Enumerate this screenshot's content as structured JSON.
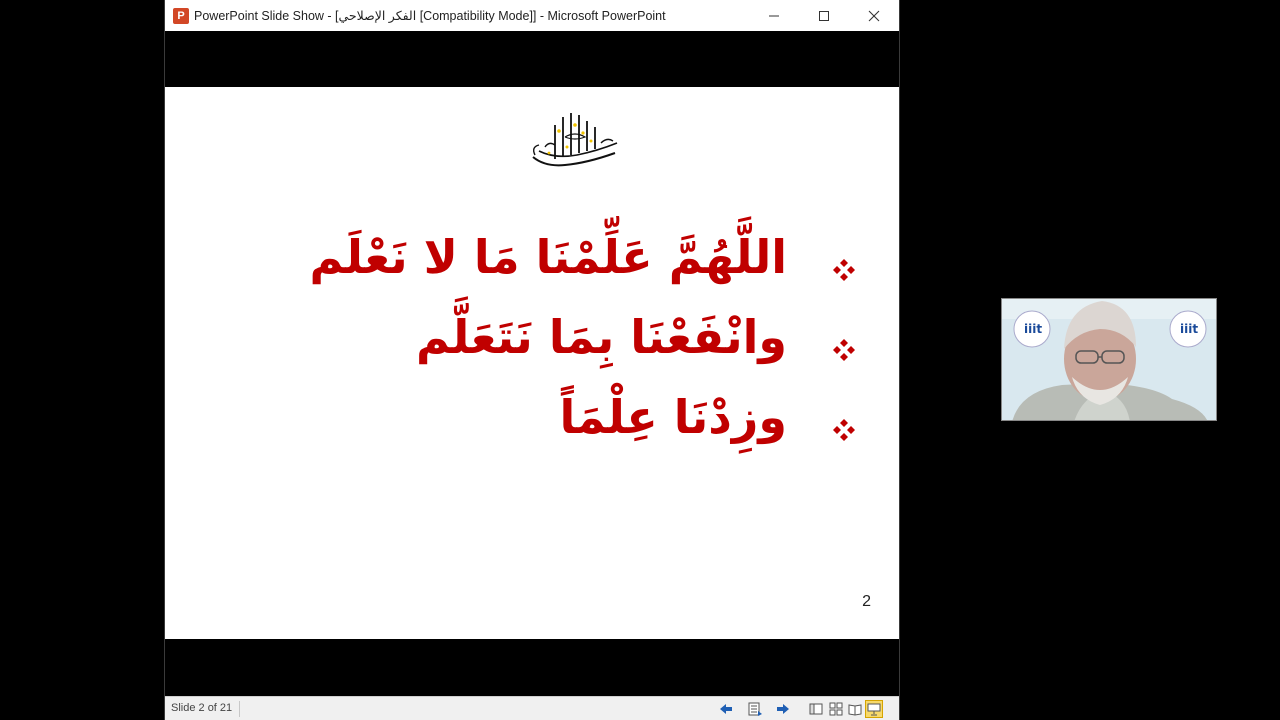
{
  "window": {
    "title": "PowerPoint Slide Show - [الفكر الإصلاحي [Compatibility Mode]] - Microsoft PowerPoint",
    "app_icon_letter": "P"
  },
  "slide": {
    "verses": [
      "اللَّهُمَّ عَلِّمْنَا مَا لا نَعْلَم",
      "وانْفَعْنَا بِمَا نَتَعَلَّم",
      "وزِدْنَا عِلْمَاً"
    ],
    "page_number": "2"
  },
  "statusbar": {
    "slide_counter": "Slide 2 of 21"
  },
  "colors": {
    "verse_text": "#c00000",
    "bullet": "#c00000",
    "accent_yellow": "#f2c400"
  },
  "icons": {
    "window_controls": [
      "minimize-icon",
      "maximize-icon",
      "close-icon"
    ],
    "statusbar": [
      "previous-slide-icon",
      "slide-menu-icon",
      "next-slide-icon",
      "normal-view-icon",
      "slide-sorter-icon",
      "reading-view-icon",
      "slide-show-icon"
    ]
  }
}
